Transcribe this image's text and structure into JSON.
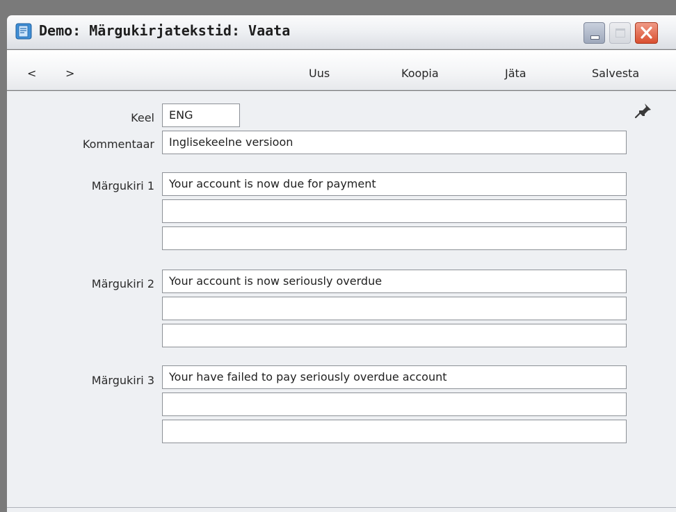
{
  "window": {
    "title": "Demo: Märgukirjatekstid: Vaata",
    "icon": "app-document-icon",
    "controls": {
      "minimize": "minimize-icon",
      "maximize": "maximize-icon",
      "close": "close-icon"
    }
  },
  "toolbar": {
    "prev_label": "<",
    "next_label": ">",
    "new_label": "Uus",
    "copy_label": "Koopia",
    "cancel_label": "Jäta",
    "save_label": "Salvesta"
  },
  "form": {
    "pin_icon": "pin-icon",
    "language": {
      "label": "Keel",
      "value": "ENG"
    },
    "comment": {
      "label": "Kommentaar",
      "value": "Inglisekeelne versioon"
    },
    "notices": [
      {
        "label": "Märgukiri 1",
        "lines": [
          "Your account is now due for payment",
          "",
          ""
        ]
      },
      {
        "label": "Märgukiri 2",
        "lines": [
          "Your account is now seriously overdue",
          "",
          ""
        ]
      },
      {
        "label": "Märgukiri 3",
        "lines": [
          "Your have failed to pay seriously overdue account",
          "",
          ""
        ]
      }
    ]
  },
  "colors": {
    "title_bar": "#eef0f3",
    "content_background": "#eef0f3",
    "close_button": "#d94f30",
    "field_border": "#8c9096"
  }
}
